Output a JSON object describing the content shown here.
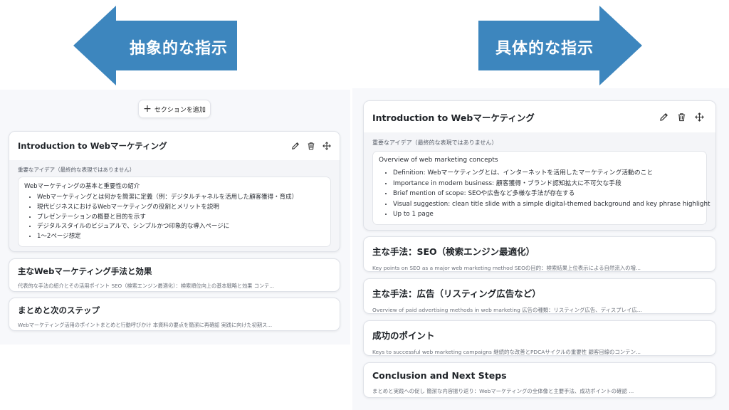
{
  "arrows": {
    "left_label": "抽象的な指示",
    "right_label": "具体的な指示",
    "color": "#3d86be"
  },
  "left_panel": {
    "add_section_label": "セクションを追加",
    "expanded_card": {
      "title": "Introduction to Webマーケティング",
      "sub_label": "重要なアイデア（最終的な表現ではありません）",
      "inner_title": "Webマーケティングの基本と重要性の紹介",
      "bullets": [
        "Webマーケティングとは何かを簡潔に定義（例：デジタルチャネルを活用した顧客獲得・育成）",
        "現代ビジネスにおけるWebマーケティングの役割とメリットを説明",
        "プレゼンテーションの概要と目的を示す",
        "デジタルスタイルのビジュアルで、シンプルかつ印象的な導入ページに",
        "1〜2ページ想定"
      ]
    },
    "cards": [
      {
        "title": "主なWebマーケティング手法と効果",
        "summary": "代表的な手法の紹介とその活用ポイント SEO（検索エンジン最適化）：検索順位向上の基本戦略と効果 コンテ..."
      },
      {
        "title": "まとめと次のステップ",
        "summary": "Webマーケティング活用のポイントまとめと行動呼びかけ 本資料の要点を簡潔に再確認 実践に向けた初期ス..."
      }
    ]
  },
  "right_panel": {
    "expanded_card": {
      "title": "Introduction to Webマーケティング",
      "sub_label": "重要なアイデア（最終的な表現ではありません）",
      "inner_title": "Overview of web marketing concepts",
      "bullets": [
        "Definition: Webマーケティングとは、インターネットを活用したマーケティング活動のこと",
        "Importance in modern business: 顧客獲得・ブランド認知拡大に不可欠な手段",
        "Brief mention of scope: SEOや広告など多様な手法が存在する",
        "Visual suggestion: clean title slide with a simple digital-themed background and key phrase highlight",
        "Up to 1 page"
      ]
    },
    "cards": [
      {
        "title": "主な手法：SEO（検索エンジン最適化）",
        "summary": "Key points on SEO as a major web marketing method SEOの目的：検索結果上位表示による自然流入の増..."
      },
      {
        "title": "主な手法：広告（リスティング広告など）",
        "summary": "Overview of paid advertising methods in web marketing 広告の種類：リスティング広告、ディスプレイ広..."
      },
      {
        "title": "成功のポイント",
        "summary": "Keys to successful web marketing campaigns 継続的な改善とPDCAサイクルの重要性 顧客目線のコンテン..."
      },
      {
        "title": "Conclusion and Next Steps",
        "summary": "まとめと実践への促し 簡潔な内容振り返り：Webマーケティングの全体像と主要手法、成功ポイントの確認 ..."
      }
    ]
  },
  "icons": {
    "edit": "pencil-icon",
    "delete": "trash-icon",
    "move": "move-icon",
    "add": "plus-icon"
  }
}
